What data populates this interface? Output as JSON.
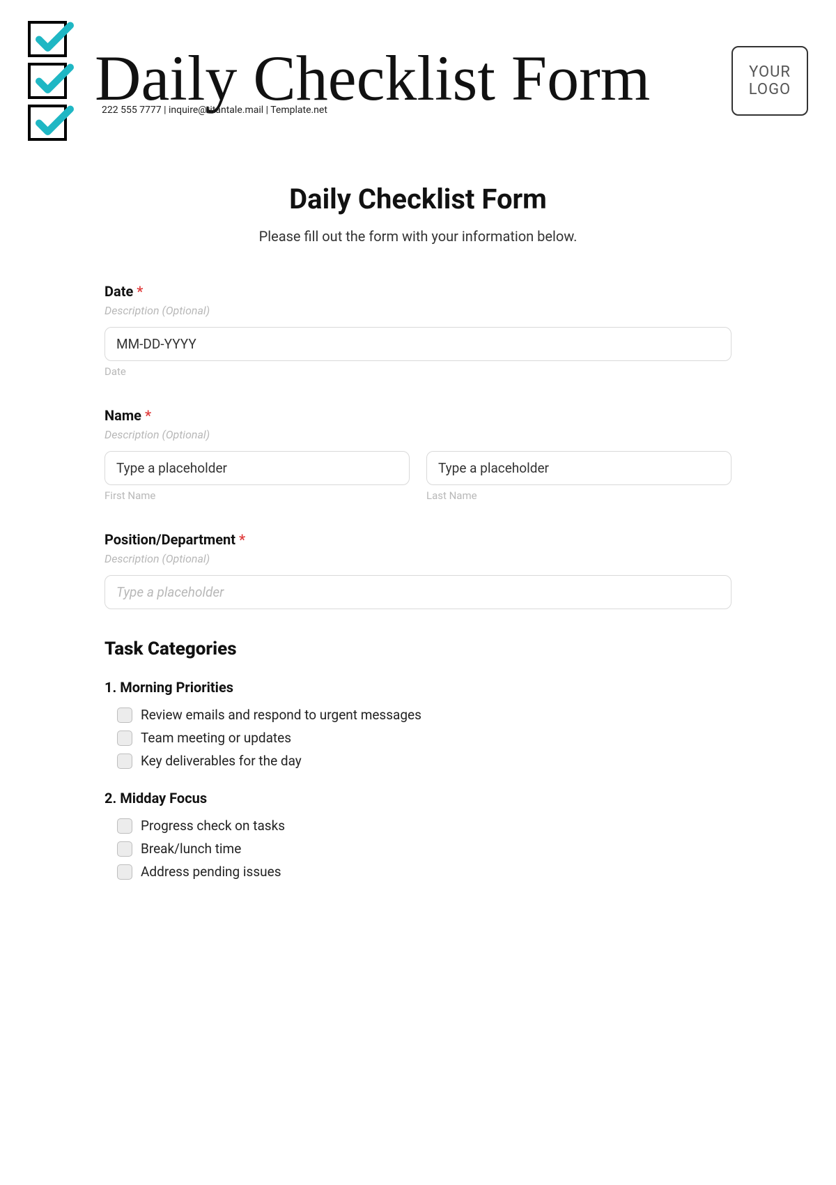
{
  "header": {
    "script_title": "Daily Checklist Form",
    "contact": "222 555 7777 | inquire@titantale.mail | Template.net",
    "logo_line1": "YOUR",
    "logo_line2": "LOGO"
  },
  "form": {
    "title": "Daily Checklist Form",
    "subtitle": "Please fill out the form with your information below.",
    "date": {
      "label": "Date",
      "required": "*",
      "desc": "Description (Optional)",
      "placeholder": "MM-DD-YYYY",
      "sublabel": "Date"
    },
    "name": {
      "label": "Name",
      "required": "*",
      "desc": "Description (Optional)",
      "first_placeholder": "Type a placeholder",
      "first_sublabel": "First Name",
      "last_placeholder": "Type a placeholder",
      "last_sublabel": "Last Name"
    },
    "position": {
      "label": "Position/Department",
      "required": "*",
      "desc": "Description (Optional)",
      "placeholder": "Type a placeholder"
    }
  },
  "tasks": {
    "heading": "Task Categories",
    "groups": [
      {
        "title": "1. Morning Priorities",
        "items": [
          "Review emails and respond to urgent messages",
          "Team meeting or updates",
          "Key deliverables for the day"
        ]
      },
      {
        "title": "2. Midday Focus",
        "items": [
          "Progress check on tasks",
          "Break/lunch time",
          "Address pending issues"
        ]
      }
    ]
  }
}
